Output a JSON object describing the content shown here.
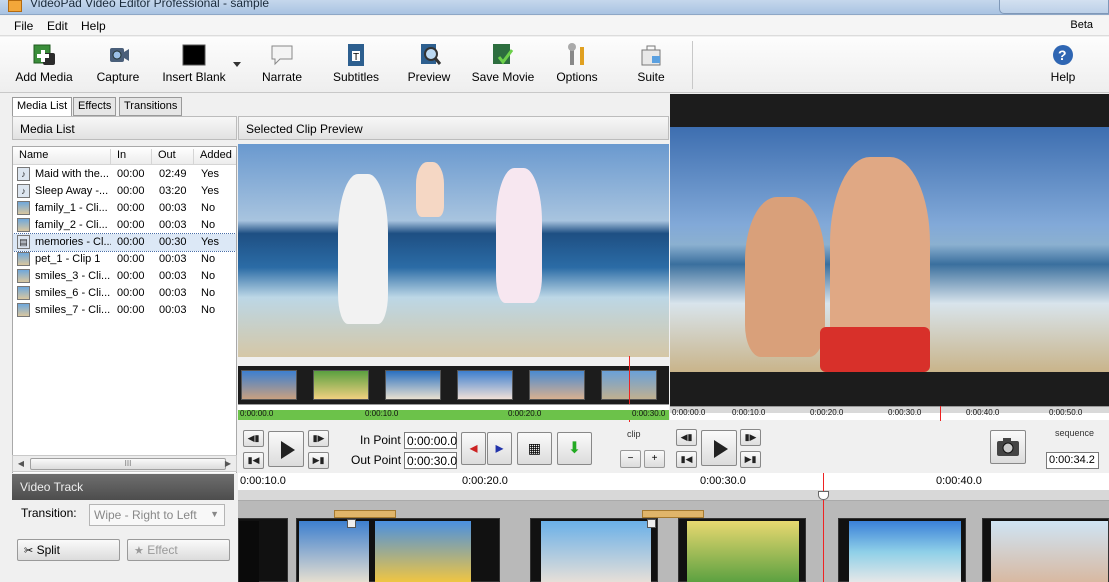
{
  "window": {
    "title": "VideoPad Video Editor Professional - sample"
  },
  "menu": {
    "file": "File",
    "edit": "Edit",
    "help": "Help",
    "beta": "Beta"
  },
  "toolbar": {
    "add_media": "Add Media",
    "capture": "Capture",
    "insert_blank": "Insert Blank",
    "narrate": "Narrate",
    "subtitles": "Subtitles",
    "preview": "Preview",
    "save_movie": "Save Movie",
    "options": "Options",
    "suite": "Suite",
    "help": "Help"
  },
  "left_tabs": [
    "Media List",
    "Effects",
    "Transitions"
  ],
  "media_list": {
    "title": "Media List",
    "columns": [
      "Name",
      "In",
      "Out",
      "Added"
    ],
    "rows": [
      {
        "name": "Maid with the...",
        "in": "00:00",
        "out": "02:49",
        "added": "Yes",
        "type": "audio"
      },
      {
        "name": "Sleep Away -...",
        "in": "00:00",
        "out": "03:20",
        "added": "Yes",
        "type": "audio"
      },
      {
        "name": "family_1 - Cli...",
        "in": "00:00",
        "out": "00:03",
        "added": "No",
        "type": "image"
      },
      {
        "name": "family_2 - Cli...",
        "in": "00:00",
        "out": "00:03",
        "added": "No",
        "type": "image"
      },
      {
        "name": "memories - Cl...",
        "in": "00:00",
        "out": "00:30",
        "added": "Yes",
        "type": "video"
      },
      {
        "name": "pet_1 - Clip 1",
        "in": "00:00",
        "out": "00:03",
        "added": "No",
        "type": "image"
      },
      {
        "name": "smiles_3 - Cli...",
        "in": "00:00",
        "out": "00:03",
        "added": "No",
        "type": "image"
      },
      {
        "name": "smiles_6 - Cli...",
        "in": "00:00",
        "out": "00:03",
        "added": "No",
        "type": "image"
      },
      {
        "name": "smiles_7 - Cli...",
        "in": "00:00",
        "out": "00:03",
        "added": "No",
        "type": "image"
      }
    ],
    "selected_index": 4
  },
  "clip_preview": {
    "title": "Selected Clip Preview",
    "ruler": [
      "0:00:00.0",
      "0:00:10.0",
      "0:00:20.0",
      "0:00:30.0"
    ],
    "in_point_label": "In Point",
    "in_point": "0:00:00.0",
    "out_point_label": "Out Point",
    "out_point": "0:00:30.0",
    "tab": "clip"
  },
  "sequence_preview": {
    "ruler": [
      "0:00:00.0",
      "0:00:10.0",
      "0:00:20.0",
      "0:00:30.0",
      "0:00:40.0",
      "0:00:50.0"
    ],
    "tab": "sequence",
    "time": "0:00:34.2"
  },
  "video_track": {
    "title": "Video Track",
    "transition_label": "Transition:",
    "transition_value": "Wipe - Right to Left",
    "split": "Split",
    "effect": "Effect"
  },
  "timeline": {
    "ruler": [
      "0:00:10.0",
      "0:00:20.0",
      "0:00:30.0",
      "0:00:40.0"
    ]
  },
  "colors": {
    "accent": "#2f66b3",
    "playhead": "#e22222",
    "clip_bar": "#6cc24a",
    "track_header": "#555555"
  }
}
